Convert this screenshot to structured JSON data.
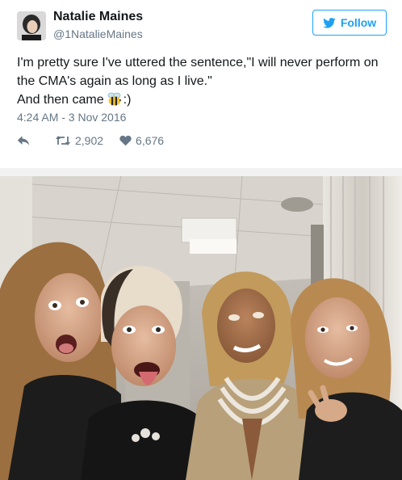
{
  "tweet": {
    "author": {
      "name": "Natalie Maines",
      "handle": "@1NatalieMaines"
    },
    "follow_label": "Follow",
    "text_lines": [
      "I'm pretty sure I've uttered the sentence,\"I will never perform on",
      "the CMA's again as long as I live.\""
    ],
    "text_last_prefix": "And then came",
    "text_last_suffix": ":)",
    "emoji": "bee-emoji",
    "timestamp": "4:24 AM - 3 Nov 2016",
    "retweets": "2,902",
    "likes": "6,676"
  },
  "icons": {
    "follow": "twitter-bird-icon",
    "reply": "reply-icon",
    "retweet": "retweet-icon",
    "like": "heart-icon"
  },
  "colors": {
    "accent": "#1da1f2",
    "secondary_text": "#657786",
    "primary_text": "#14171a"
  },
  "photo": {
    "alt": ""
  }
}
